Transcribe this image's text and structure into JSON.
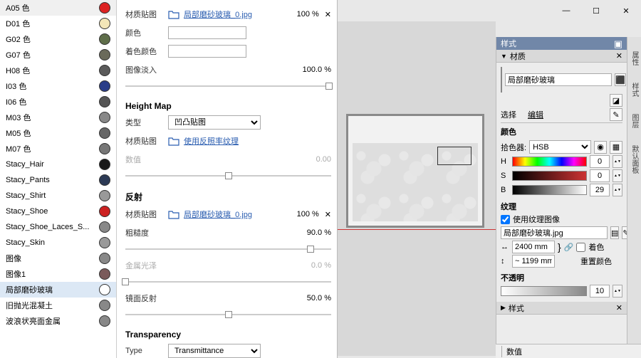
{
  "window": {
    "min": "—",
    "max": "☐",
    "close": "✕"
  },
  "materials": [
    {
      "name": "A05 色",
      "color": "#d22"
    },
    {
      "name": "D01 色",
      "color": "#f3e6b8"
    },
    {
      "name": "G02 色",
      "color": "#5f6e4a"
    },
    {
      "name": "G07 色",
      "color": "#6a6a5a"
    },
    {
      "name": "H08 色",
      "color": "#5a5a5a"
    },
    {
      "name": "I03 色",
      "color": "#2a3d88"
    },
    {
      "name": "I06 色",
      "color": "#555"
    },
    {
      "name": "M03 色",
      "color": "#888"
    },
    {
      "name": "M05 色",
      "color": "#666"
    },
    {
      "name": "M07 色",
      "color": "#777"
    },
    {
      "name": "Stacy_Hair",
      "color": "#1a1a1a"
    },
    {
      "name": "Stacy_Pants",
      "color": "#2c3a55"
    },
    {
      "name": "Stacy_Shirt",
      "color": "#999"
    },
    {
      "name": "Stacy_Shoe",
      "color": "#c22"
    },
    {
      "name": "Stacy_Shoe_Laces_S...",
      "color": "#888"
    },
    {
      "name": "Stacy_Skin",
      "color": "#999"
    },
    {
      "name": "图像",
      "color": "#888"
    },
    {
      "name": "图像1",
      "color": "#7a5a5a"
    },
    {
      "name": "局部磨砂玻璃",
      "color": "#ffffff",
      "sel": true
    },
    {
      "name": "旧抛光混凝土",
      "color": "#888"
    },
    {
      "name": "波浪状亮面金属",
      "color": "#888"
    }
  ],
  "props": {
    "texLabel": "材质贴图",
    "texFile": "局部磨砂玻璃_0.jpg",
    "texPct": "100 %",
    "colorLabel": "颜色",
    "tintLabel": "着色颜色",
    "fadeLabel": "图像淡入",
    "fadePct": "100.0  %",
    "heightSection": "Height Map",
    "typeLabel": "类型",
    "typeValue": "凹凸贴图",
    "hmTexLabel": "材质贴图",
    "hmLink": "使用反照率纹理",
    "valueLabel": "数值",
    "valuePct": "0.00",
    "reflSection": "反射",
    "rTexLabel": "材质贴图",
    "rTexFile": "局部磨砂玻璃_0.jpg",
    "rTexPct": "100 %",
    "roughLabel": "粗糙度",
    "roughPct": "90.0  %",
    "metalLabel": "金属光泽",
    "metalPct": "0.0  %",
    "specLabel": "镜面反射",
    "specPct": "50.0  %",
    "transSection": "Transparency",
    "transTypeLabel": "Type",
    "transTypeVal": "Transmittance"
  },
  "right": {
    "trayTitle": "样式",
    "tabs": [
      "属性",
      "样式",
      "图层",
      "默认面板"
    ],
    "matPanel": "材质",
    "matName": "局部磨砂玻璃",
    "selTab": "选择",
    "editTab": "编辑",
    "colorPanel": "颜色",
    "pickerLabel": "拾色器:",
    "pickerVal": "HSB",
    "hLabel": "H",
    "hVal": "0",
    "sLabel": "S",
    "sVal": "0",
    "bLabel": "B",
    "bVal": "29",
    "texPanel": "纹理",
    "useTex": "使用纹理图像",
    "texFile": "局部磨砂玻璃.jpg",
    "w": "2400 mm",
    "h": "~ 1199 mm",
    "tint": "着色",
    "resetColor": "重置颜色",
    "opacityPanel": "不透明",
    "opacityVal": "10",
    "stylePanel": "样式",
    "status": "数值"
  }
}
